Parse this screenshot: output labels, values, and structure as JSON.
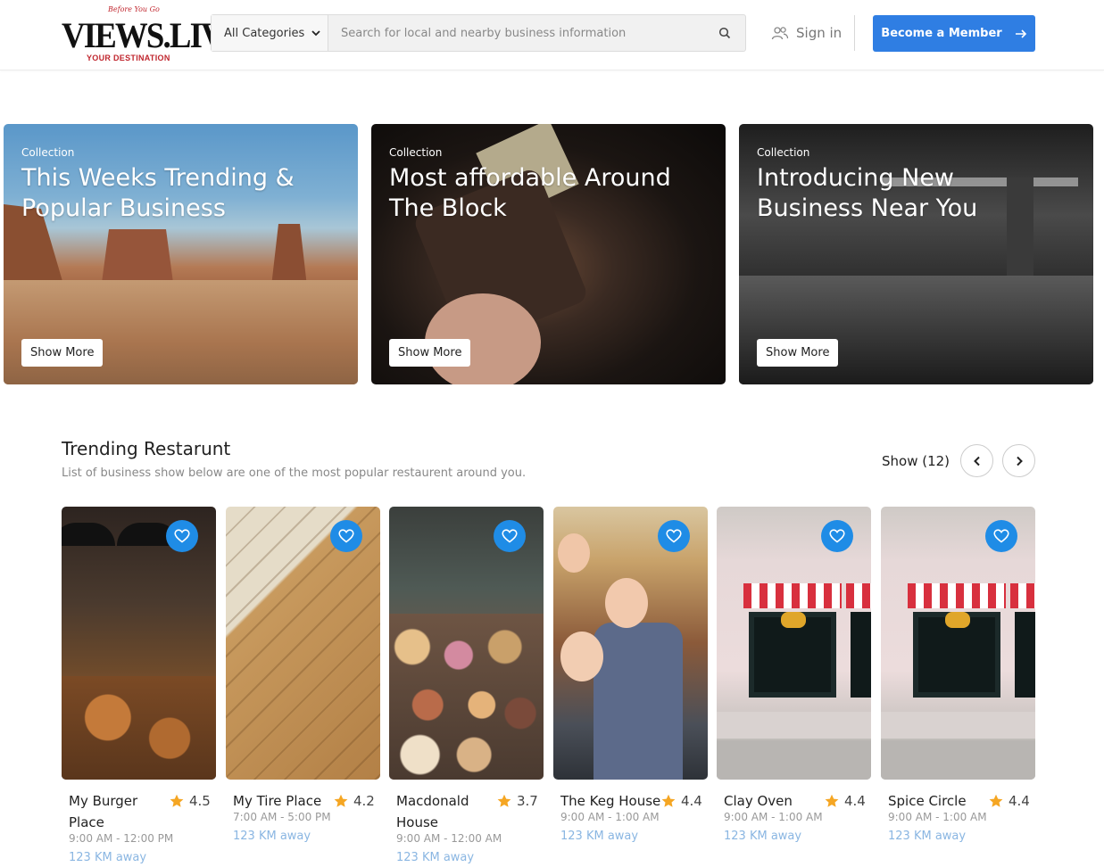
{
  "header": {
    "logo": {
      "tagline": "Before You Go",
      "name": "VIEWS.LIVE",
      "subtitle": "YOUR DESTINATION"
    },
    "category_select": {
      "value": "All Categories"
    },
    "search": {
      "placeholder": "Search for local and nearby business information"
    },
    "signin_label": "Sign in",
    "member_button_label": "Become a Member"
  },
  "collections": [
    {
      "kicker": "Collection",
      "title": "This Weeks Trending & Popular Business",
      "button": "Show More"
    },
    {
      "kicker": "Collection",
      "title": "Most affordable Around The Block",
      "button": "Show More"
    },
    {
      "kicker": "Collection",
      "title": "Introducing New Business Near You",
      "button": "Show More"
    }
  ],
  "trending": {
    "title": "Trending Restarunt",
    "subtitle": "List of business show below are one of the most popular restaurent around you.",
    "show_count": "Show (12)",
    "items": [
      {
        "name": "My Burger Place",
        "rating": "4.5",
        "hours": "9:00 AM - 12:00 PM",
        "distance": "123 KM away"
      },
      {
        "name": "My Tire Place",
        "rating": "4.2",
        "hours": "7:00 AM - 5:00 PM",
        "distance": "123 KM away"
      },
      {
        "name": "Macdonald House",
        "rating": "3.7",
        "hours": "9:00 AM - 12:00 AM",
        "distance": "123 KM away"
      },
      {
        "name": "The Keg House",
        "rating": "4.4",
        "hours": "9:00 AM - 1:00 AM",
        "distance": "123 KM away"
      },
      {
        "name": "Clay Oven",
        "rating": "4.4",
        "hours": "9:00 AM - 1:00 AM",
        "distance": "123 KM away"
      },
      {
        "name": "Spice Circle",
        "rating": "4.4",
        "hours": "9:00 AM - 1:00 AM",
        "distance": "123 KM away"
      }
    ]
  },
  "icons": {
    "search": "search-icon",
    "users": "users-icon",
    "arrow_right": "arrow-right-icon",
    "chevron_left": "chevron-left-icon",
    "chevron_right": "chevron-right-icon",
    "heart": "heart-icon",
    "star": "star-icon",
    "chevron_down": "chevron-down-icon"
  },
  "colors": {
    "primary": "#2f7ee3",
    "heart_bg": "#1f8ce6",
    "star": "#f5a623",
    "distance": "#8ab6e2",
    "logo_red": "#c0262e"
  }
}
